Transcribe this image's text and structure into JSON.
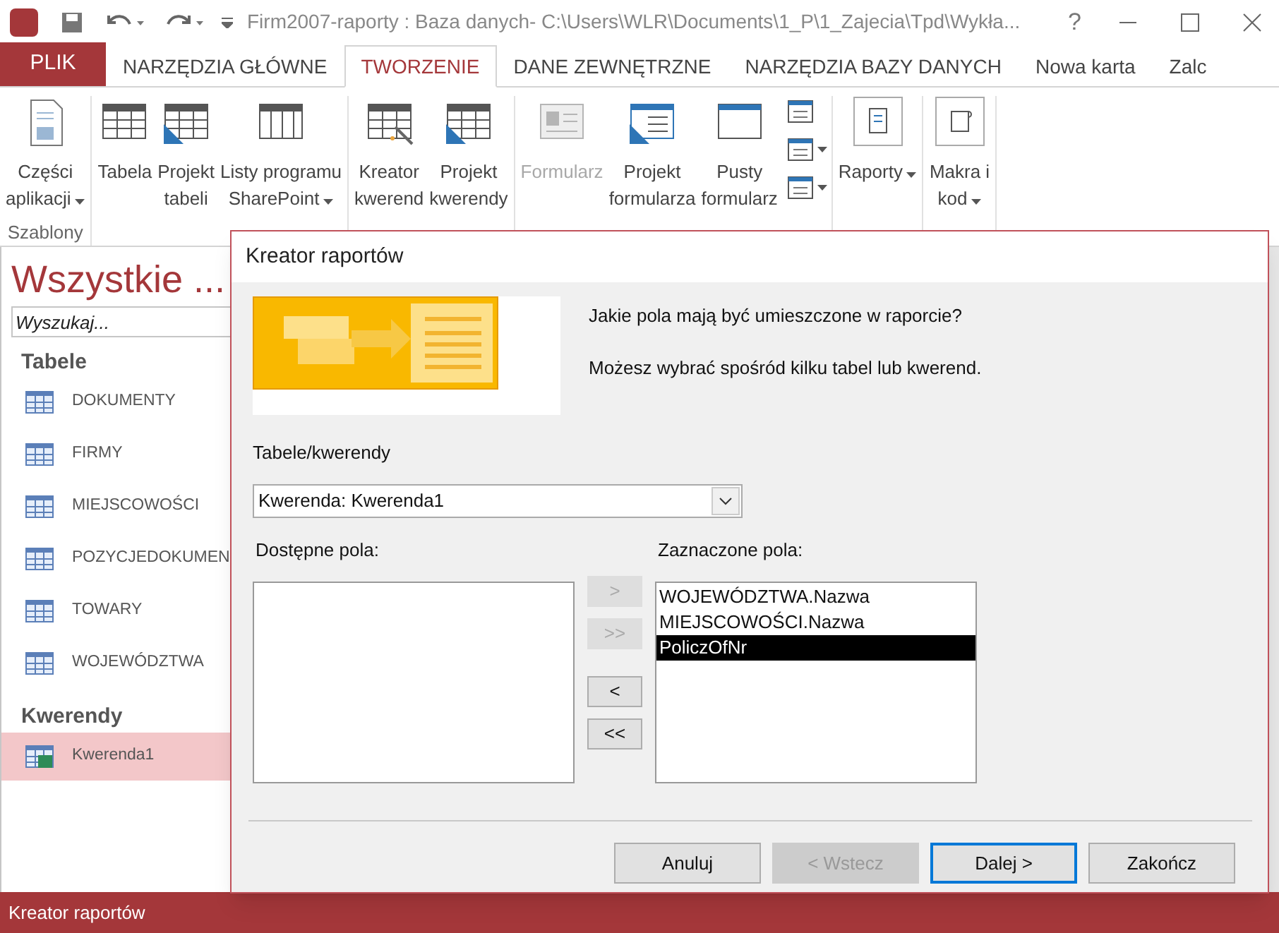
{
  "window": {
    "title": "Firm2007-raporty : Baza danych- C:\\Users\\WLR\\Documents\\1_P\\1_Zajecia\\Tpd\\Wykła...",
    "help": "?"
  },
  "ribbon_tabs": [
    {
      "label": "PLIK",
      "kind": "file",
      "selected": false
    },
    {
      "label": "NARZĘDZIA GŁÓWNE",
      "kind": "tab",
      "selected": false
    },
    {
      "label": "TWORZENIE",
      "kind": "tab",
      "selected": true
    },
    {
      "label": "DANE ZEWNĘTRZNE",
      "kind": "tab",
      "selected": false
    },
    {
      "label": "NARZĘDZIA BAZY DANYCH",
      "kind": "tab",
      "selected": false
    },
    {
      "label": "Nowa karta",
      "kind": "tab",
      "selected": false
    },
    {
      "label": "Zalc",
      "kind": "tab",
      "selected": false
    }
  ],
  "ribbon_groups": [
    {
      "label": "Szablony",
      "buttons": [
        {
          "kind": "parts",
          "lines": [
            "Części",
            "aplikacji"
          ],
          "dropdown": true,
          "disabled": false
        }
      ]
    },
    {
      "buttons": [
        {
          "kind": "table",
          "lines": [
            "Tabela"
          ],
          "dropdown": false,
          "disabled": false
        },
        {
          "kind": "design",
          "lines": [
            "Projekt",
            "tabeli"
          ],
          "dropdown": false,
          "disabled": false
        },
        {
          "kind": "list",
          "lines": [
            "Listy programu",
            "SharePoint"
          ],
          "dropdown": true,
          "disabled": false
        }
      ]
    },
    {
      "buttons": [
        {
          "kind": "wizard",
          "lines": [
            "Kreator",
            "kwerend"
          ],
          "dropdown": false,
          "disabled": false
        },
        {
          "kind": "design",
          "lines": [
            "Projekt",
            "kwerendy"
          ],
          "dropdown": false,
          "disabled": false
        }
      ]
    },
    {
      "buttons": [
        {
          "kind": "form",
          "lines": [
            "Formularz"
          ],
          "dropdown": false,
          "disabled": true
        },
        {
          "kind": "formdesign",
          "lines": [
            "Projekt",
            "formularza"
          ],
          "dropdown": false,
          "disabled": false
        },
        {
          "kind": "blank",
          "lines": [
            "Pusty",
            "formularz"
          ],
          "dropdown": false,
          "disabled": false
        }
      ],
      "small_buttons": [
        {
          "dropdown": false
        },
        {
          "dropdown": true
        },
        {
          "dropdown": true
        }
      ]
    },
    {
      "buttons": [
        {
          "kind": "report",
          "lines": [
            "Raporty"
          ],
          "dropdown": true,
          "disabled": false
        }
      ]
    },
    {
      "buttons": [
        {
          "kind": "macro",
          "lines": [
            "Makra i",
            "kod"
          ],
          "dropdown": true,
          "disabled": false
        }
      ]
    }
  ],
  "navigation": {
    "title": "Wszystkie ...",
    "search": {
      "placeholder": "Wyszukaj..."
    },
    "sections": [
      {
        "heading": "Tabele",
        "items": [
          {
            "label": "DOKUMENTY",
            "kind": "table",
            "selected": false
          },
          {
            "label": "FIRMY",
            "kind": "table",
            "selected": false
          },
          {
            "label": "MIEJSCOWOŚCI",
            "kind": "table",
            "selected": false
          },
          {
            "label": "POZYCJEDOKUMEN",
            "kind": "table",
            "selected": false
          },
          {
            "label": "TOWARY",
            "kind": "table",
            "selected": false
          },
          {
            "label": "WOJEWÓDZTWA",
            "kind": "table",
            "selected": false
          }
        ]
      },
      {
        "heading": "Kwerendy",
        "items": [
          {
            "label": "Kwerenda1",
            "kind": "query",
            "selected": true
          }
        ]
      }
    ]
  },
  "dialog": {
    "title": "Kreator raportów",
    "question": "Jakie pola mają być umieszczone w raporcie?",
    "hint": "Możesz wybrać spośród kilku tabel lub kwerend.",
    "source_label": "Tabele/kwerendy",
    "source_value": "Kwerenda: Kwerenda1",
    "available_label": "Dostępne pola:",
    "selected_label": "Zaznaczone pola:",
    "selected_fields": [
      {
        "label": "WOJEWÓDZTWA.Nazwa",
        "selected": false
      },
      {
        "label": "MIEJSCOWOŚCI.Nazwa",
        "selected": false
      },
      {
        "label": "PoliczOfNr",
        "selected": true
      }
    ],
    "move_buttons": [
      {
        "label": ">",
        "disabled": true
      },
      {
        "label": ">>",
        "disabled": true
      },
      {
        "label": "<",
        "disabled": false
      },
      {
        "label": "<<",
        "disabled": false
      }
    ],
    "buttons": [
      {
        "label": "Anuluj",
        "disabled": false,
        "default": false
      },
      {
        "label": "< Wstecz",
        "disabled": true,
        "default": false
      },
      {
        "label": "Dalej >",
        "disabled": false,
        "default": true
      },
      {
        "label": "Zakończ",
        "disabled": false,
        "default": false
      }
    ]
  },
  "status_bar": {
    "text": "Kreator raportów"
  }
}
